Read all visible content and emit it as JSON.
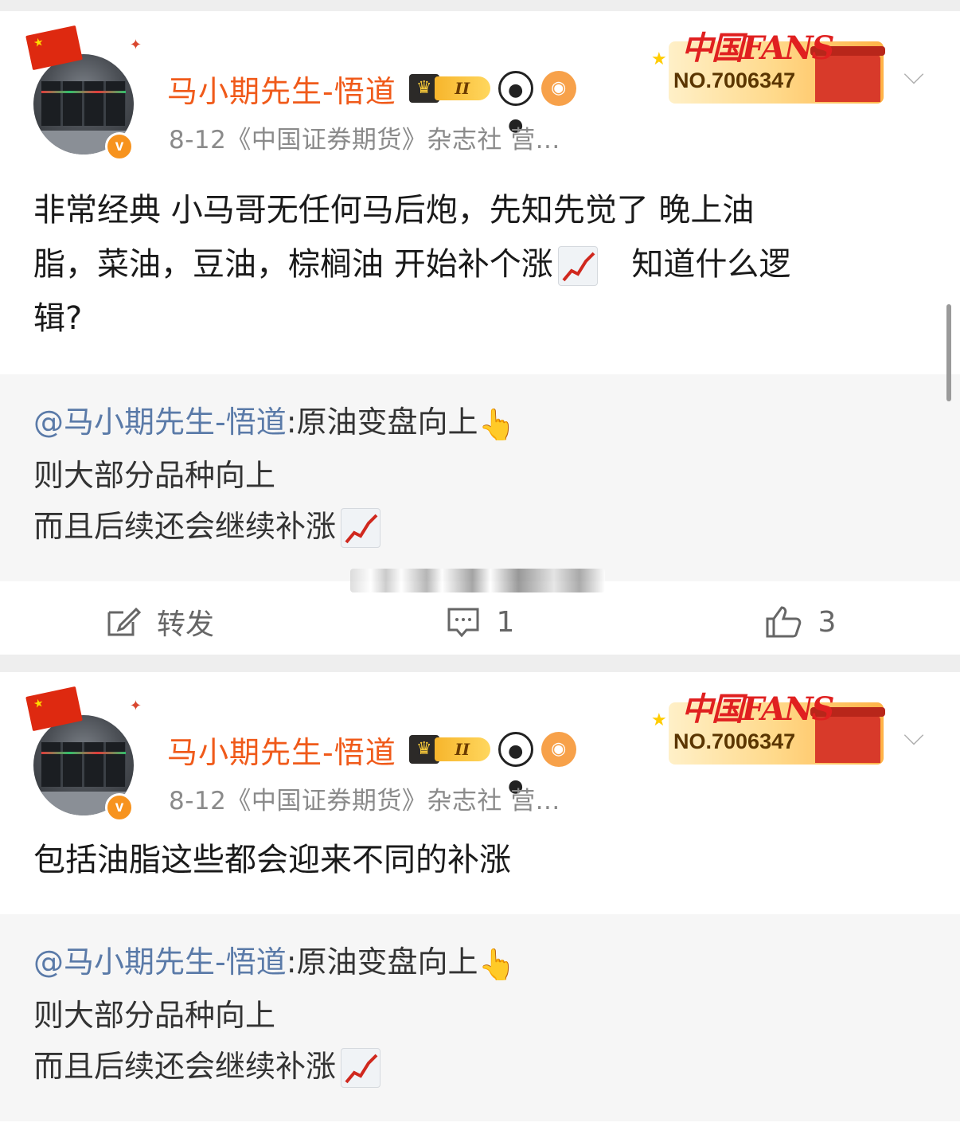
{
  "posts": [
    {
      "author": "马小期先生-悟道",
      "level_badge": "II",
      "meta": "8-12《中国证券期货》杂志社 营...",
      "fans_card": {
        "logo": "中国FANS",
        "number": "NO.7006347"
      },
      "body_lines": [
        "非常经典 小马哥无任何马后炮，先知先觉了 晚上油",
        "脂，菜油，豆油，棕榈油 开始补个涨",
        "知道什么逻",
        "辑?"
      ],
      "quote": {
        "mention": "@马小期先生-悟道",
        "line1_rest": ":原油变盘向上",
        "line2": "则大部分品种向上",
        "line3": "而且后续还会继续补涨"
      },
      "actions": {
        "repost_label": "转发",
        "comment_count": "1",
        "like_count": "3"
      }
    },
    {
      "author": "马小期先生-悟道",
      "level_badge": "II",
      "meta": "8-12《中国证券期货》杂志社 营...",
      "fans_card": {
        "logo": "中国FANS",
        "number": "NO.7006347"
      },
      "body_lines": [
        "包括油脂这些都会迎来不同的补涨"
      ],
      "quote": {
        "mention": "@马小期先生-悟道",
        "line1_rest": ":原油变盘向上",
        "line2": "则大部分品种向上",
        "line3": "而且后续还会继续补涨"
      }
    }
  ],
  "icons": {
    "pointing_up": "👆",
    "chart_increasing": "chart-up-icon",
    "repost": "edit-square-icon",
    "comment": "comment-icon",
    "like": "thumbs-up-icon",
    "expand": "chevron-down-icon"
  },
  "colors": {
    "author_name": "#f05a1a",
    "mention": "#5a7aa8",
    "meta_text": "#8a8a8a",
    "quote_bg": "#f6f6f6",
    "verified_badge": "#f7931e"
  }
}
